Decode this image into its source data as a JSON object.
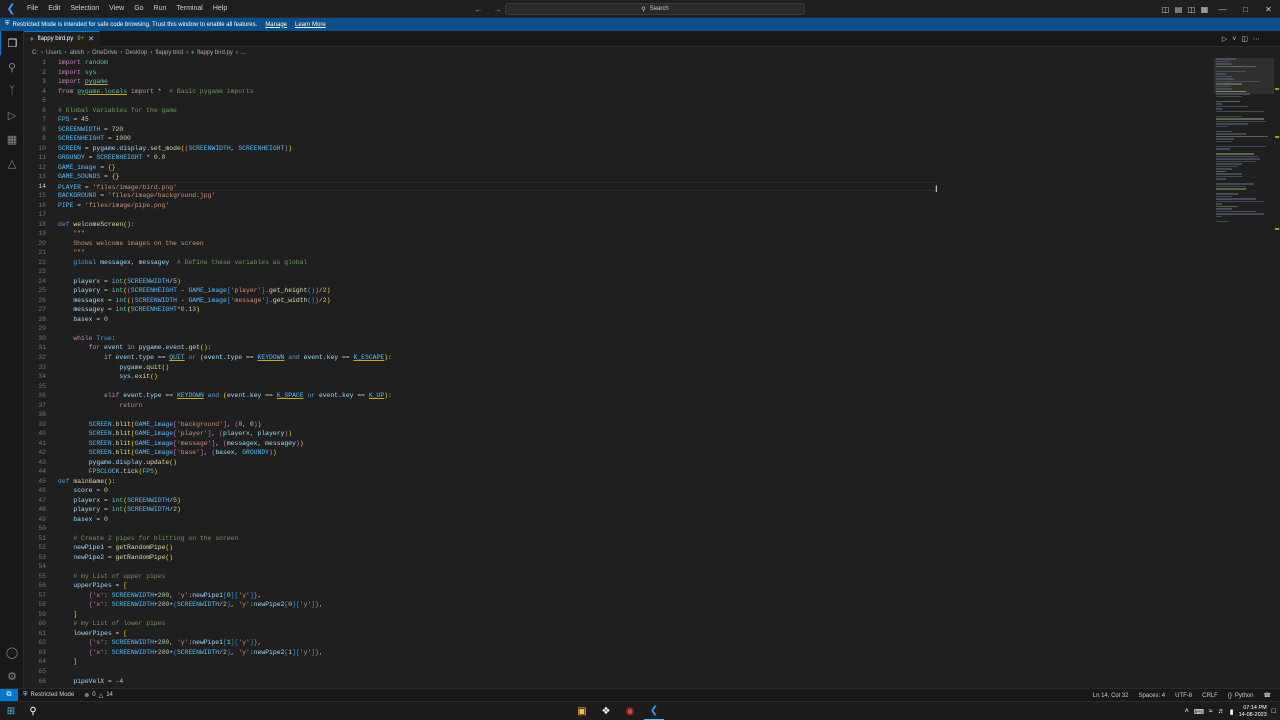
{
  "titlebar": {
    "menu": [
      "File",
      "Edit",
      "Selection",
      "View",
      "Go",
      "Run",
      "Terminal",
      "Help"
    ],
    "search_label": "Search"
  },
  "banner": {
    "text": "Restricted Mode is intended for safe code browsing. Trust this window to enable all features.",
    "manage": "Manage",
    "learn_more": "Learn More"
  },
  "tab": {
    "filename": "flappy bird.py",
    "badge": "9+"
  },
  "breadcrumb": [
    "C:",
    "Users",
    "abish",
    "OneDrive",
    "Desktop",
    "flappy bird",
    "flappy bird.py",
    "..."
  ],
  "editor": {
    "current_line": 14,
    "line_numbers": [
      "1",
      "2",
      "3",
      "4",
      "5",
      "6",
      "7",
      "8",
      "9",
      "10",
      "11",
      "12",
      "13",
      "14",
      "15",
      "16",
      "17",
      "18",
      "19",
      "20",
      "21",
      "22",
      "23",
      "24",
      "25",
      "26",
      "27",
      "28",
      "29",
      "30",
      "31",
      "32",
      "33",
      "34",
      "35",
      "36",
      "37",
      "38",
      "39",
      "40",
      "41",
      "42",
      "43",
      "44",
      "45",
      "46",
      "47",
      "48",
      "49",
      "50",
      "51",
      "52",
      "53",
      "54",
      "55",
      "56",
      "57",
      "58",
      "59",
      "60",
      "61",
      "62",
      "63",
      "64",
      "65",
      "66"
    ]
  },
  "statusbar": {
    "restricted": "Restricted Mode",
    "errors": "0",
    "warnings": "14",
    "position": "Ln 14, Col 32",
    "spaces": "Spaces: 4",
    "encoding": "UTF-8",
    "eol": "CRLF",
    "language": "Python"
  },
  "taskbar": {
    "time": "07:14 PM",
    "date": "14-08-2023"
  },
  "colors": {
    "accent": "#0078d4",
    "banner": "#0b4f8a",
    "editor_bg": "#1f1f1f"
  },
  "icons": [
    "vscode-icon",
    "explorer-icon",
    "search-icon",
    "source-control-icon",
    "run-debug-icon",
    "extensions-icon",
    "testing-icon",
    "account-icon",
    "settings-icon",
    "python-file-icon",
    "windows-start-icon",
    "file-explorer-icon",
    "chrome-icon"
  ]
}
